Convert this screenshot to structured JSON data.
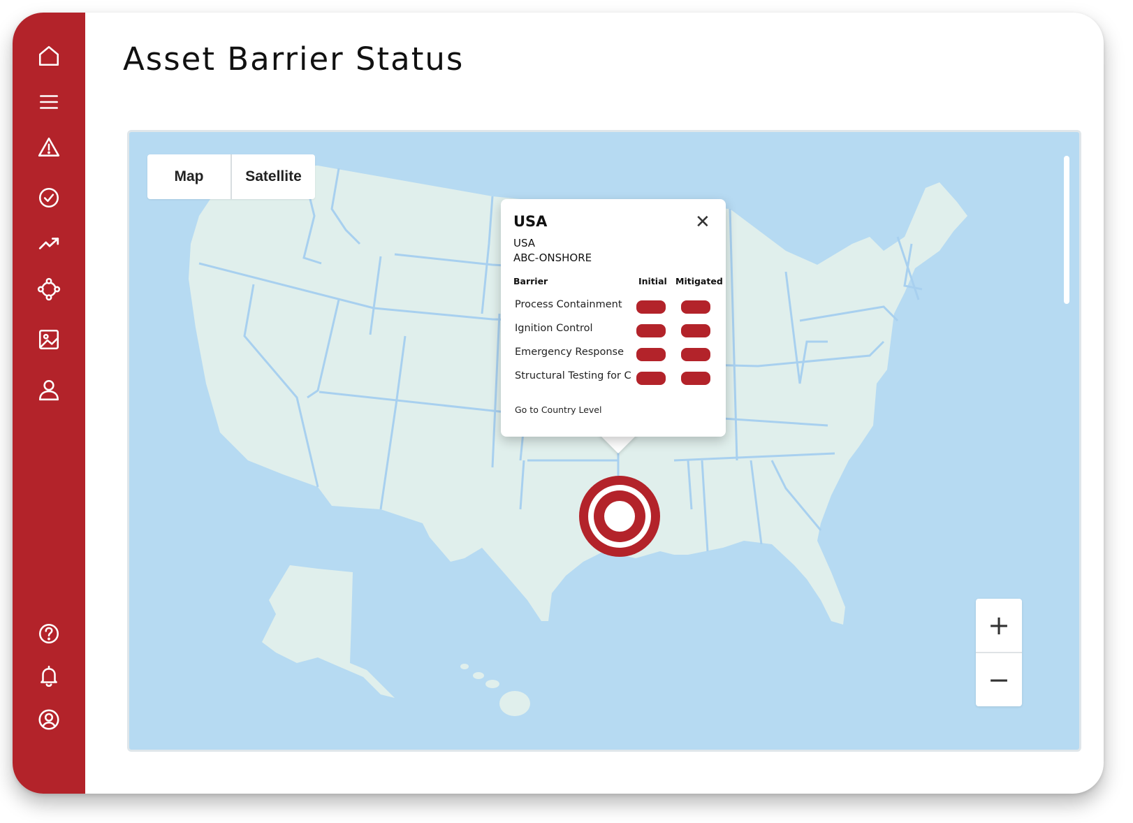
{
  "page": {
    "title": "Asset Barrier Status"
  },
  "sidebar": {
    "top_icons": [
      "home-icon",
      "menu-icon",
      "warning-icon",
      "check-circle-icon",
      "trend-up-icon",
      "network-icon",
      "image-icon",
      "user-icon"
    ],
    "bottom_icons": [
      "help-icon",
      "bell-icon",
      "account-circle-icon"
    ],
    "accent_color": "#b3232a"
  },
  "map": {
    "toggle": {
      "map_label": "Map",
      "satellite_label": "Satellite"
    },
    "zoom": {
      "in_label": "+",
      "out_label": "−"
    },
    "water_color": "#b6daf2",
    "land_color": "#e0efec",
    "border_color": "#a8d0ef"
  },
  "popup": {
    "title": "USA",
    "country": "USA",
    "asset": "ABC-ONSHORE",
    "columns": {
      "barrier": "Barrier",
      "initial": "Initial",
      "mitigated": "Mitigated"
    },
    "rows": [
      {
        "name": "Process Containment",
        "initial": "red",
        "mitigated": "red"
      },
      {
        "name": "Ignition Control",
        "initial": "red",
        "mitigated": "red"
      },
      {
        "name": "Emergency Response",
        "initial": "red",
        "mitigated": "red"
      },
      {
        "name": "Structural Testing for C",
        "initial": "red",
        "mitigated": "red"
      }
    ],
    "link": "Go to Country Level"
  }
}
